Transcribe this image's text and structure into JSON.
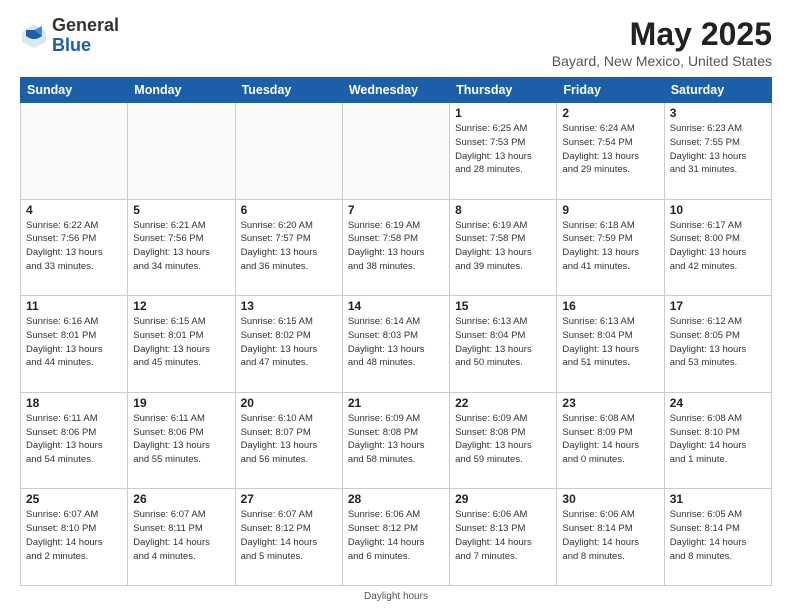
{
  "logo": {
    "general": "General",
    "blue": "Blue"
  },
  "title": "May 2025",
  "location": "Bayard, New Mexico, United States",
  "footer": "Daylight hours",
  "days_header": [
    "Sunday",
    "Monday",
    "Tuesday",
    "Wednesday",
    "Thursday",
    "Friday",
    "Saturday"
  ],
  "weeks": [
    [
      {
        "day": "",
        "info": ""
      },
      {
        "day": "",
        "info": ""
      },
      {
        "day": "",
        "info": ""
      },
      {
        "day": "",
        "info": ""
      },
      {
        "day": "1",
        "info": "Sunrise: 6:25 AM\nSunset: 7:53 PM\nDaylight: 13 hours\nand 28 minutes."
      },
      {
        "day": "2",
        "info": "Sunrise: 6:24 AM\nSunset: 7:54 PM\nDaylight: 13 hours\nand 29 minutes."
      },
      {
        "day": "3",
        "info": "Sunrise: 6:23 AM\nSunset: 7:55 PM\nDaylight: 13 hours\nand 31 minutes."
      }
    ],
    [
      {
        "day": "4",
        "info": "Sunrise: 6:22 AM\nSunset: 7:56 PM\nDaylight: 13 hours\nand 33 minutes."
      },
      {
        "day": "5",
        "info": "Sunrise: 6:21 AM\nSunset: 7:56 PM\nDaylight: 13 hours\nand 34 minutes."
      },
      {
        "day": "6",
        "info": "Sunrise: 6:20 AM\nSunset: 7:57 PM\nDaylight: 13 hours\nand 36 minutes."
      },
      {
        "day": "7",
        "info": "Sunrise: 6:19 AM\nSunset: 7:58 PM\nDaylight: 13 hours\nand 38 minutes."
      },
      {
        "day": "8",
        "info": "Sunrise: 6:19 AM\nSunset: 7:58 PM\nDaylight: 13 hours\nand 39 minutes."
      },
      {
        "day": "9",
        "info": "Sunrise: 6:18 AM\nSunset: 7:59 PM\nDaylight: 13 hours\nand 41 minutes."
      },
      {
        "day": "10",
        "info": "Sunrise: 6:17 AM\nSunset: 8:00 PM\nDaylight: 13 hours\nand 42 minutes."
      }
    ],
    [
      {
        "day": "11",
        "info": "Sunrise: 6:16 AM\nSunset: 8:01 PM\nDaylight: 13 hours\nand 44 minutes."
      },
      {
        "day": "12",
        "info": "Sunrise: 6:15 AM\nSunset: 8:01 PM\nDaylight: 13 hours\nand 45 minutes."
      },
      {
        "day": "13",
        "info": "Sunrise: 6:15 AM\nSunset: 8:02 PM\nDaylight: 13 hours\nand 47 minutes."
      },
      {
        "day": "14",
        "info": "Sunrise: 6:14 AM\nSunset: 8:03 PM\nDaylight: 13 hours\nand 48 minutes."
      },
      {
        "day": "15",
        "info": "Sunrise: 6:13 AM\nSunset: 8:04 PM\nDaylight: 13 hours\nand 50 minutes."
      },
      {
        "day": "16",
        "info": "Sunrise: 6:13 AM\nSunset: 8:04 PM\nDaylight: 13 hours\nand 51 minutes."
      },
      {
        "day": "17",
        "info": "Sunrise: 6:12 AM\nSunset: 8:05 PM\nDaylight: 13 hours\nand 53 minutes."
      }
    ],
    [
      {
        "day": "18",
        "info": "Sunrise: 6:11 AM\nSunset: 8:06 PM\nDaylight: 13 hours\nand 54 minutes."
      },
      {
        "day": "19",
        "info": "Sunrise: 6:11 AM\nSunset: 8:06 PM\nDaylight: 13 hours\nand 55 minutes."
      },
      {
        "day": "20",
        "info": "Sunrise: 6:10 AM\nSunset: 8:07 PM\nDaylight: 13 hours\nand 56 minutes."
      },
      {
        "day": "21",
        "info": "Sunrise: 6:09 AM\nSunset: 8:08 PM\nDaylight: 13 hours\nand 58 minutes."
      },
      {
        "day": "22",
        "info": "Sunrise: 6:09 AM\nSunset: 8:08 PM\nDaylight: 13 hours\nand 59 minutes."
      },
      {
        "day": "23",
        "info": "Sunrise: 6:08 AM\nSunset: 8:09 PM\nDaylight: 14 hours\nand 0 minutes."
      },
      {
        "day": "24",
        "info": "Sunrise: 6:08 AM\nSunset: 8:10 PM\nDaylight: 14 hours\nand 1 minute."
      }
    ],
    [
      {
        "day": "25",
        "info": "Sunrise: 6:07 AM\nSunset: 8:10 PM\nDaylight: 14 hours\nand 2 minutes."
      },
      {
        "day": "26",
        "info": "Sunrise: 6:07 AM\nSunset: 8:11 PM\nDaylight: 14 hours\nand 4 minutes."
      },
      {
        "day": "27",
        "info": "Sunrise: 6:07 AM\nSunset: 8:12 PM\nDaylight: 14 hours\nand 5 minutes."
      },
      {
        "day": "28",
        "info": "Sunrise: 6:06 AM\nSunset: 8:12 PM\nDaylight: 14 hours\nand 6 minutes."
      },
      {
        "day": "29",
        "info": "Sunrise: 6:06 AM\nSunset: 8:13 PM\nDaylight: 14 hours\nand 7 minutes."
      },
      {
        "day": "30",
        "info": "Sunrise: 6:06 AM\nSunset: 8:14 PM\nDaylight: 14 hours\nand 8 minutes."
      },
      {
        "day": "31",
        "info": "Sunrise: 6:05 AM\nSunset: 8:14 PM\nDaylight: 14 hours\nand 8 minutes."
      }
    ]
  ]
}
